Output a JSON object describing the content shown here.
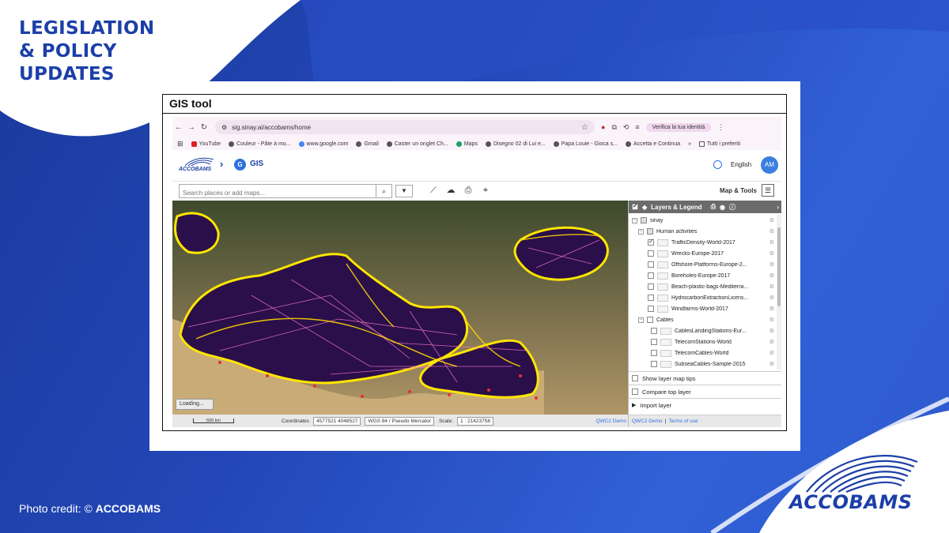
{
  "headline": [
    "LEGISLATION",
    "& POLICY",
    "UPDATES"
  ],
  "photo_credit": {
    "prefix": "Photo credit: © ",
    "name": "ACCOBAMS"
  },
  "brand_name": "ACCOBAMS",
  "colors": {
    "brand_blue": "#1c3fa8",
    "bg_blue": "#2347b8",
    "heat_yellow": "#ffe600",
    "heat_purple": "#6a1b9a"
  },
  "frame_title": "GIS tool",
  "browser": {
    "url": "sig.sinay.ai/accobams/home",
    "identity_button": "Verifica la tua identità",
    "bookmarks": [
      {
        "label": "YouTube",
        "icon": "youtube-icon"
      },
      {
        "label": "Couleur - Pâte à mo...",
        "icon": "globe-icon"
      },
      {
        "label": "www.google.com",
        "icon": "google-icon"
      },
      {
        "label": "Gmail",
        "icon": "globe-icon"
      },
      {
        "label": "Caster un onglet Ch...",
        "icon": "globe-icon"
      },
      {
        "label": "Maps",
        "icon": "maps-icon"
      },
      {
        "label": "Disegno 02 di Lui e...",
        "icon": "globe-icon"
      },
      {
        "label": "Papa Louie - Gioca s...",
        "icon": "globe-icon"
      },
      {
        "label": "Accetta e Continua",
        "icon": "globe-icon"
      }
    ],
    "bookmarks_overflow": "»",
    "all_bookmarks": "Tutti i preferiti"
  },
  "app": {
    "logo_text": "ACCOBAMS",
    "gis_badge": "G",
    "gis_title": "GIS",
    "language": "English",
    "avatar_initials": "AM",
    "search_placeholder": "Search places or add maps...",
    "map_tools_label": "Map & Tools"
  },
  "layers_panel": {
    "title": "Layers & Legend",
    "rows": [
      {
        "label": "sinay",
        "level": 0,
        "type": "group",
        "checked": "part"
      },
      {
        "label": "Human activities",
        "level": 1,
        "type": "group",
        "checked": "part"
      },
      {
        "label": "TrafficDensity-World-2017",
        "level": 2,
        "type": "layer",
        "checked": "on"
      },
      {
        "label": "Wrecks-Europe-2017",
        "level": 2,
        "type": "layer",
        "checked": "off"
      },
      {
        "label": "Offshore-Platforms-Europe-2...",
        "level": 2,
        "type": "layer",
        "checked": "off"
      },
      {
        "label": "Boreholes-Europe-2017",
        "level": 2,
        "type": "layer",
        "checked": "off"
      },
      {
        "label": "Beach-plastic-bags-Mediterra...",
        "level": 2,
        "type": "layer",
        "checked": "off"
      },
      {
        "label": "HydrocarbonExtractionLicens...",
        "level": 2,
        "type": "layer",
        "checked": "off"
      },
      {
        "label": "Windfarms-World-2017",
        "level": 2,
        "type": "layer",
        "checked": "off"
      },
      {
        "label": "Cables",
        "level": 1,
        "type": "group",
        "checked": "off"
      },
      {
        "label": "CablesLandingStations-Eur...",
        "level": 2,
        "type": "layer",
        "checked": "off"
      },
      {
        "label": "TelecomStations-World",
        "level": 2,
        "type": "layer",
        "checked": "off"
      },
      {
        "label": "TelecomCables-World",
        "level": 2,
        "type": "layer",
        "checked": "off"
      },
      {
        "label": "SubseaCables-Sample-2015",
        "level": 2,
        "type": "layer",
        "checked": "off"
      }
    ],
    "show_tips": "Show layer map tips",
    "compare_top": "Compare top layer",
    "import_layer": "Import layer"
  },
  "map": {
    "loading": "Loading...",
    "scalebar": "500 km",
    "coordinates_label": "Coordinates",
    "coordinates_value": "4577521 4048527",
    "crs": "WGS 84 / Pseudo Mercator",
    "scale_label": "Scale:",
    "scale_value": "1 : 21423758",
    "qwc_link": "QWC2 Demo",
    "separator": "|",
    "terms_link": "Terms of use"
  }
}
